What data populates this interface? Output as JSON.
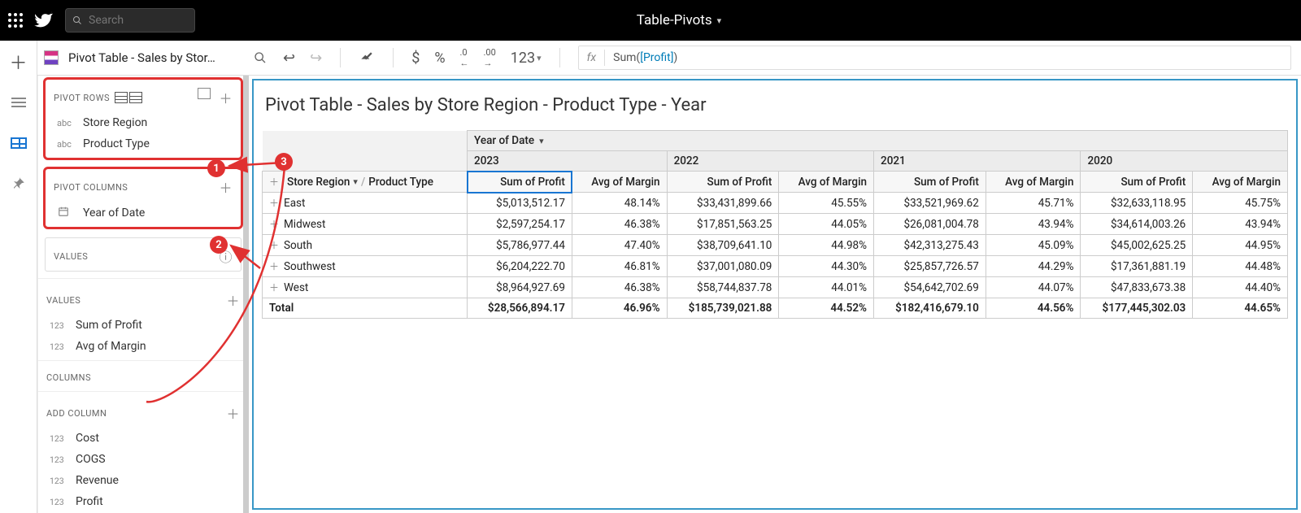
{
  "top": {
    "search_placeholder": "Search",
    "document_title": "Table-Pivots"
  },
  "page": {
    "tab_title": "Pivot Table - Sales by Stor…"
  },
  "toolbar": {
    "currency": "$",
    "percent": "%",
    "dec_dec": ".0",
    "dec_inc": ".00",
    "num_fmt": "123"
  },
  "formula_bar": {
    "fx_label": "fx",
    "prefix": "Sum(",
    "field": "[Profit]",
    "suffix": ")"
  },
  "sidebar": {
    "sections": {
      "pivot_rows": {
        "label": "PIVOT ROWS",
        "items": [
          "Store Region",
          "Product Type"
        ]
      },
      "pivot_columns": {
        "label": "PIVOT COLUMNS",
        "items": [
          "Year of Date"
        ]
      },
      "values_label": "VALUES",
      "values_header": "VALUES",
      "values": [
        "Sum of Profit",
        "Avg of Margin"
      ],
      "columns_label": "COLUMNS",
      "add_column_label": "ADD COLUMN",
      "add_columns": [
        "Cost",
        "COGS",
        "Revenue",
        "Profit"
      ]
    }
  },
  "callouts": {
    "one": "1",
    "two": "2",
    "three": "3"
  },
  "chart_data": {
    "type": "table",
    "title": "Pivot Table - Sales by Store Region - Product Type - Year",
    "column_header_field": "Year of Date",
    "row_header_field": "Store Region",
    "row_sub_field": "Product Type",
    "years": [
      "2023",
      "2022",
      "2021",
      "2020"
    ],
    "measures": [
      "Sum of Profit",
      "Avg of Margin"
    ],
    "rows": [
      {
        "region": "East",
        "values": [
          "$5,013,512.17",
          "48.14%",
          "$33,431,899.66",
          "45.55%",
          "$33,521,969.62",
          "45.71%",
          "$32,633,118.95",
          "45.75%"
        ]
      },
      {
        "region": "Midwest",
        "values": [
          "$2,597,254.17",
          "46.38%",
          "$17,851,563.25",
          "44.05%",
          "$26,081,004.78",
          "43.94%",
          "$34,614,003.26",
          "43.94%"
        ]
      },
      {
        "region": "South",
        "values": [
          "$5,786,977.44",
          "47.40%",
          "$38,709,641.10",
          "44.98%",
          "$42,313,275.43",
          "45.09%",
          "$45,002,625.25",
          "44.95%"
        ]
      },
      {
        "region": "Southwest",
        "values": [
          "$6,204,222.70",
          "46.81%",
          "$37,001,080.09",
          "44.30%",
          "$25,857,726.57",
          "44.29%",
          "$17,361,881.19",
          "44.48%"
        ]
      },
      {
        "region": "West",
        "values": [
          "$8,964,927.69",
          "46.38%",
          "$58,744,837.78",
          "44.01%",
          "$54,642,702.69",
          "44.07%",
          "$47,833,673.38",
          "44.40%"
        ]
      }
    ],
    "total": {
      "label": "Total",
      "values": [
        "$28,566,894.17",
        "46.96%",
        "$185,739,021.88",
        "44.52%",
        "$182,416,679.10",
        "44.56%",
        "$177,445,302.03",
        "44.65%"
      ]
    }
  }
}
